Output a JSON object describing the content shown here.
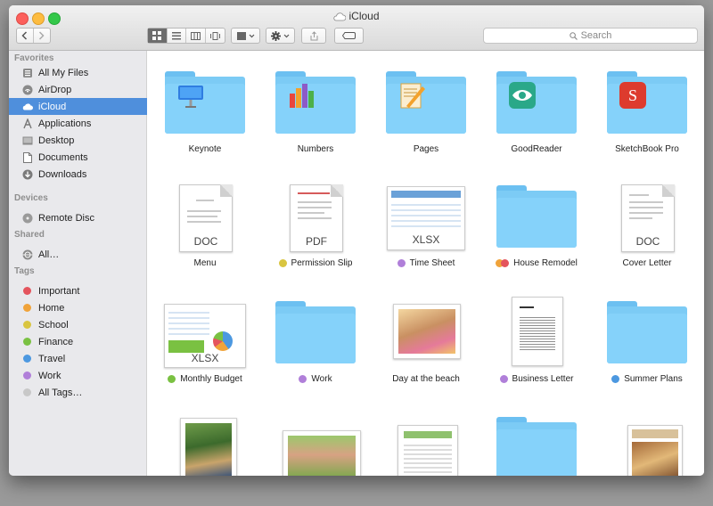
{
  "window": {
    "title": "iCloud"
  },
  "search": {
    "placeholder": "Search"
  },
  "sidebar": {
    "favorites_header": "Favorites",
    "favorites": [
      {
        "label": "All My Files",
        "icon": "all-files-icon"
      },
      {
        "label": "AirDrop",
        "icon": "airdrop-icon"
      },
      {
        "label": "iCloud",
        "icon": "cloud-icon",
        "selected": true
      },
      {
        "label": "Applications",
        "icon": "applications-icon"
      },
      {
        "label": "Desktop",
        "icon": "desktop-icon"
      },
      {
        "label": "Documents",
        "icon": "documents-icon"
      },
      {
        "label": "Downloads",
        "icon": "downloads-icon"
      }
    ],
    "devices_header": "Devices",
    "devices": [
      {
        "label": "Remote Disc",
        "icon": "disc-icon"
      }
    ],
    "shared_header": "Shared",
    "shared": [
      {
        "label": "All…",
        "icon": "network-icon"
      }
    ],
    "tags_header": "Tags",
    "tags": [
      {
        "label": "Important",
        "color": "#e4545d"
      },
      {
        "label": "Home",
        "color": "#f0a33a"
      },
      {
        "label": "School",
        "color": "#d9c540"
      },
      {
        "label": "Finance",
        "color": "#7ac142"
      },
      {
        "label": "Travel",
        "color": "#4c98e0"
      },
      {
        "label": "Work",
        "color": "#b07fd9"
      },
      {
        "label": "All Tags…",
        "color": "#c8c8c8"
      }
    ]
  },
  "files": [
    {
      "label": "Keynote",
      "kind": "folder",
      "icon": "keynote-icon"
    },
    {
      "label": "Numbers",
      "kind": "folder",
      "icon": "numbers-icon"
    },
    {
      "label": "Pages",
      "kind": "folder",
      "icon": "pages-icon"
    },
    {
      "label": "GoodReader",
      "kind": "folder",
      "icon": "goodreader-icon"
    },
    {
      "label": "SketchBook Pro",
      "kind": "folder",
      "icon": "sketchbook-icon"
    },
    {
      "label": "Menu",
      "kind": "doc",
      "ext": "DOC"
    },
    {
      "label": "Permission Slip",
      "kind": "doc",
      "ext": "PDF",
      "tag": "#d9c540"
    },
    {
      "label": "Time Sheet",
      "kind": "sheet",
      "ext": "XLSX",
      "tag": "#b07fd9"
    },
    {
      "label": "House Remodel",
      "kind": "folder",
      "tags": [
        "#f0a33a",
        "#e4545d"
      ]
    },
    {
      "label": "Cover Letter",
      "kind": "doc",
      "ext": "DOC"
    },
    {
      "label": "Monthly Budget",
      "kind": "sheet",
      "ext": "XLSX",
      "tag": "#7ac142"
    },
    {
      "label": "Work",
      "kind": "folder",
      "tag": "#b07fd9"
    },
    {
      "label": "Day at the beach",
      "kind": "photo"
    },
    {
      "label": "Business Letter",
      "kind": "letter",
      "tag": "#b07fd9"
    },
    {
      "label": "Summer Plans",
      "kind": "folder",
      "tag": "#4c98e0"
    },
    {
      "label": "",
      "kind": "photo"
    },
    {
      "label": "",
      "kind": "photo"
    },
    {
      "label": "",
      "kind": "sheet"
    },
    {
      "label": "",
      "kind": "folder"
    },
    {
      "label": "",
      "kind": "doc"
    }
  ]
}
